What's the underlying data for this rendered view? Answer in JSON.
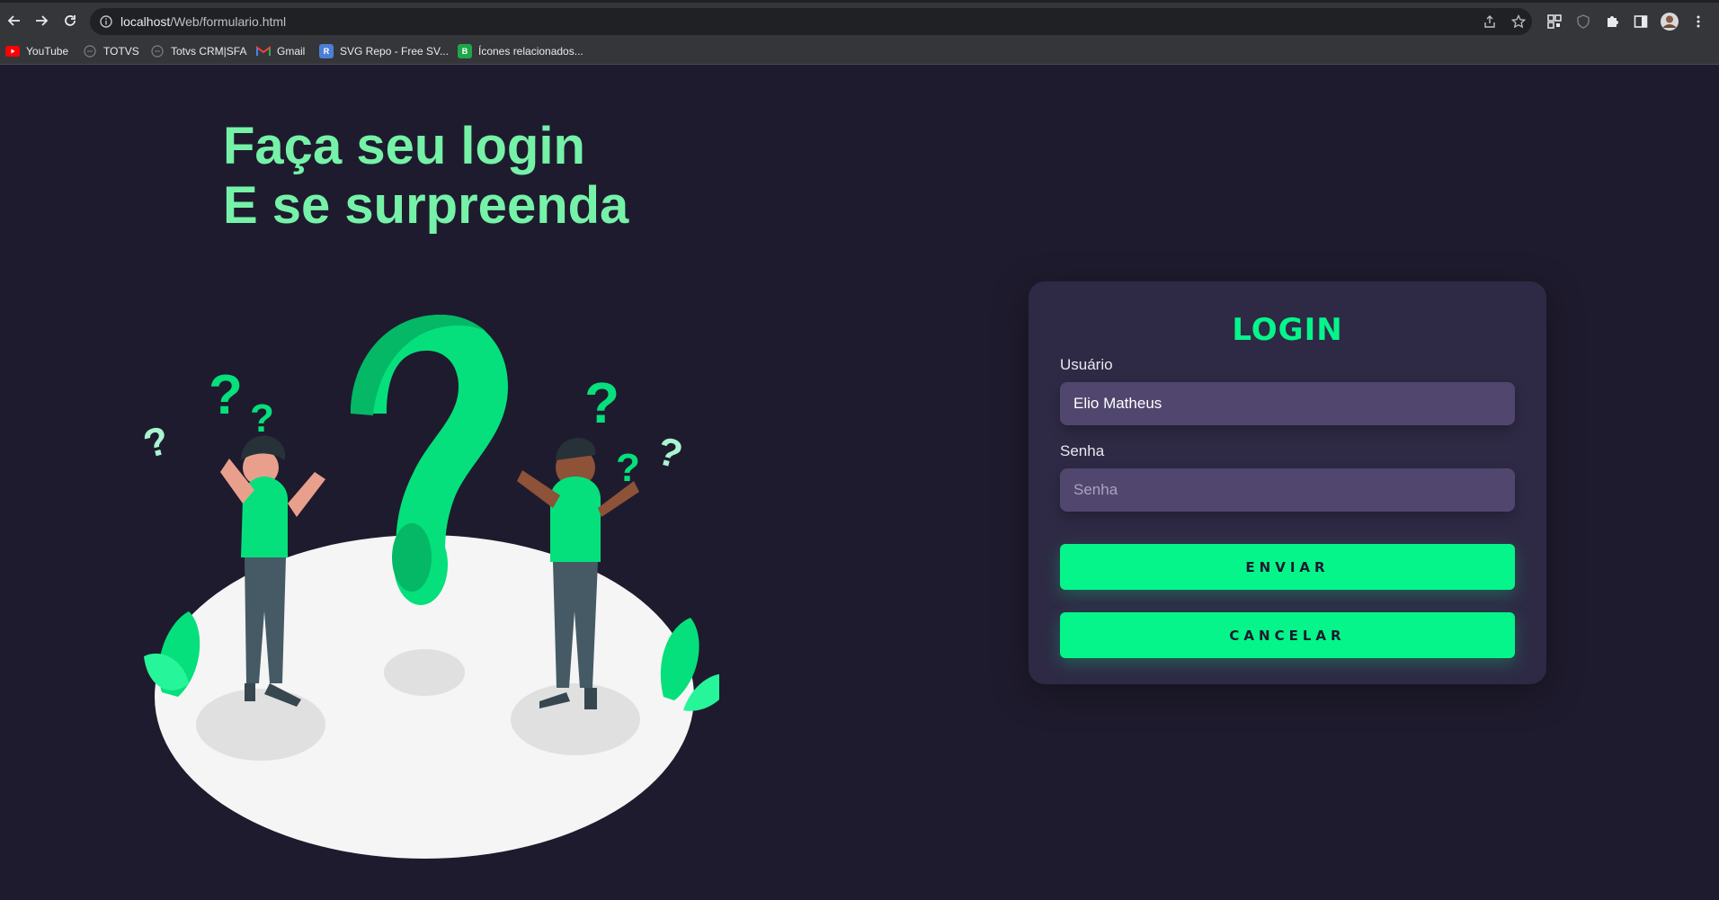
{
  "browser": {
    "url_host": "localhost",
    "url_path": "/Web/formulario.html",
    "bookmarks": [
      {
        "label": "YouTube",
        "icon": "youtube-icon"
      },
      {
        "label": "TOTVS",
        "icon": "globe-icon"
      },
      {
        "label": "Totvs CRM|SFA",
        "icon": "globe-icon"
      },
      {
        "label": "Gmail",
        "icon": "gmail-icon"
      },
      {
        "label": "SVG Repo - Free SV...",
        "icon": "svgrepo-icon"
      },
      {
        "label": "Ícones relacionados...",
        "icon": "green-icon"
      }
    ]
  },
  "page": {
    "headline_line1": "Faça seu login",
    "headline_line2": "E se surpreenda"
  },
  "login": {
    "title": "LOGIN",
    "user_label": "Usuário",
    "user_value": "Elio Matheus",
    "password_label": "Senha",
    "password_placeholder": "Senha",
    "submit_label": "ENVIAR",
    "cancel_label": "CANCELAR"
  },
  "colors": {
    "background": "#1f1b2e",
    "accent": "#05f58a",
    "headline": "#75f2a8",
    "card": "#2e2a45",
    "input": "#51476e"
  }
}
